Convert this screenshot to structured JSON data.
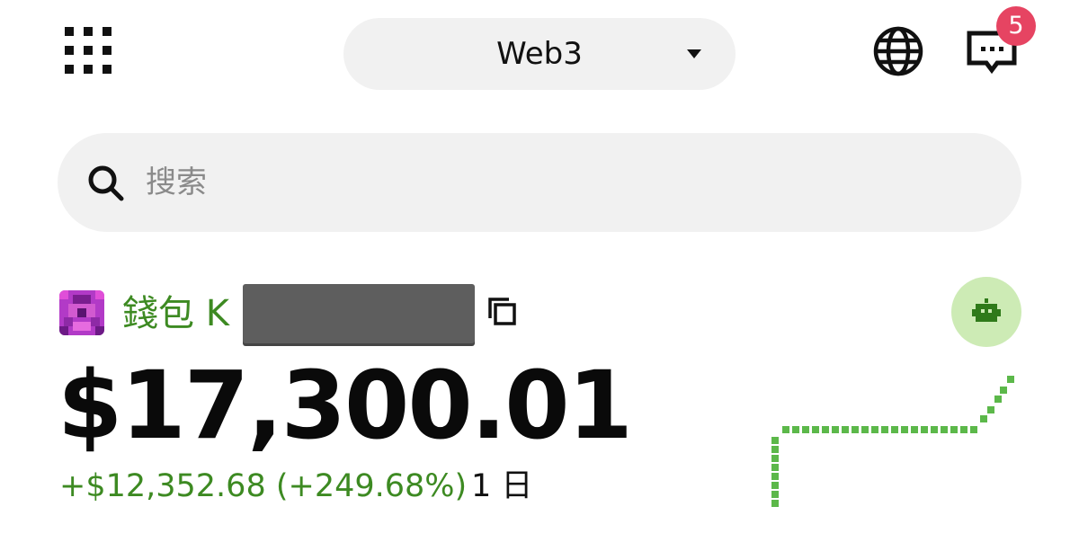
{
  "header": {
    "apps_icon": "grid-icon",
    "network_switcher": {
      "label": "Web3",
      "caret_icon": "caret-down-icon"
    },
    "language_icon": "globe-icon",
    "messages": {
      "icon": "chat-icon",
      "badge": "5",
      "badge_color": "#e64462"
    }
  },
  "search": {
    "placeholder": "搜索",
    "value": "",
    "icon": "search-icon"
  },
  "wallet": {
    "name": "錢包 K",
    "copy_icon": "copy-icon",
    "bot_icon": "robot-icon",
    "balance": "$17,300.01",
    "change": "+$12,352.68 (+249.68%)",
    "period": "1 日",
    "accent_color": "#3d8a22"
  }
}
